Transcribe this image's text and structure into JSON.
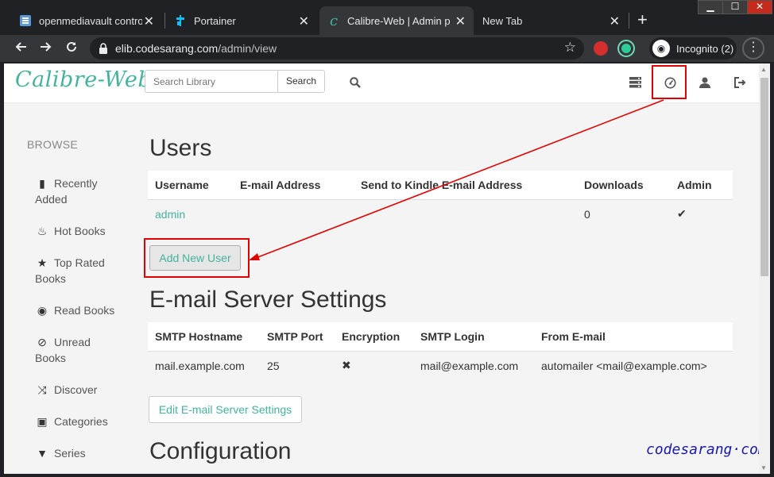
{
  "browser": {
    "tabs": [
      {
        "title": "openmediavault control",
        "icon": "openmediavault-icon"
      },
      {
        "title": "Portainer",
        "icon": "portainer-icon"
      },
      {
        "title": "Calibre-Web | Admin pa",
        "icon": "calibre-icon"
      },
      {
        "title": "New Tab",
        "icon": ""
      }
    ],
    "active_tab": 2,
    "url_host": "elib.codesarang.com",
    "url_path": "/admin/view",
    "profile_label": "Incognito (2)"
  },
  "app": {
    "logo": "Calibre-Web",
    "search_placeholder": "Search Library",
    "search_button": "Search"
  },
  "sidebar": {
    "heading": "BROWSE",
    "items": [
      {
        "line1": "Recently",
        "line2": "Added",
        "icon": "book-icon"
      },
      {
        "line1": "Hot Books",
        "line2": "",
        "icon": "fire-icon"
      },
      {
        "line1": "Top Rated",
        "line2": "Books",
        "icon": "star-icon"
      },
      {
        "line1": "Read Books",
        "line2": "",
        "icon": "eye-icon"
      },
      {
        "line1": "Unread",
        "line2": "Books",
        "icon": "eye-slash-icon"
      },
      {
        "line1": "Discover",
        "line2": "",
        "icon": "random-icon"
      },
      {
        "line1": "Categories",
        "line2": "",
        "icon": "inbox-icon"
      },
      {
        "line1": "Series",
        "line2": "",
        "icon": "bookmark-icon"
      }
    ]
  },
  "users": {
    "heading": "Users",
    "columns": [
      "Username",
      "E-mail Address",
      "Send to Kindle E-mail Address",
      "Downloads",
      "Admin"
    ],
    "rows": [
      {
        "username": "admin",
        "email": "",
        "kindle": "",
        "downloads": "0",
        "admin": "✔"
      }
    ],
    "add_button": "Add New User"
  },
  "email_settings": {
    "heading": "E-mail Server Settings",
    "columns": [
      "SMTP Hostname",
      "SMTP Port",
      "Encryption",
      "SMTP Login",
      "From E-mail"
    ],
    "row": {
      "host": "mail.example.com",
      "port": "25",
      "encryption": "✖",
      "login": "mail@example.com",
      "from": "automailer <mail@example.com>"
    },
    "edit_button": "Edit E-mail Server Settings"
  },
  "configuration": {
    "heading": "Configuration"
  },
  "watermark": "codesarang·com",
  "annotation_color": "#e00000"
}
